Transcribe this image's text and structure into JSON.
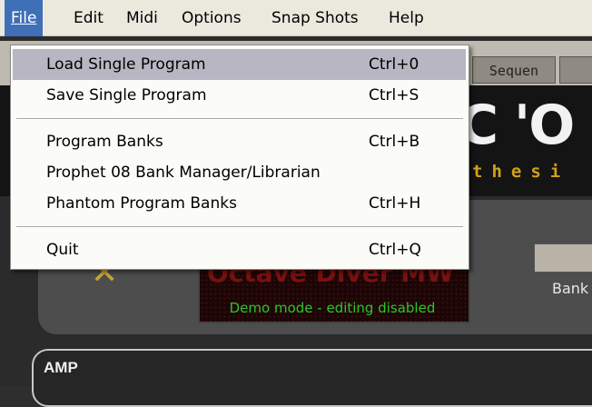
{
  "menubar": {
    "items": [
      {
        "label": "File"
      },
      {
        "label": "Edit"
      },
      {
        "label": "Midi"
      },
      {
        "label": "Options"
      },
      {
        "label": "Snap Shots"
      },
      {
        "label": "Help"
      }
    ]
  },
  "file_menu": {
    "items": [
      {
        "label": "Load Single Program",
        "shortcut": "Ctrl+0"
      },
      {
        "label": "Save Single Program",
        "shortcut": "Ctrl+S"
      },
      {
        "label": "Program Banks",
        "shortcut": "Ctrl+B"
      },
      {
        "label": "Prophet 08 Bank Manager/Librarian",
        "shortcut": ""
      },
      {
        "label": "Phantom Program Banks",
        "shortcut": "Ctrl+H"
      },
      {
        "label": "Quit",
        "shortcut": "Ctrl+Q"
      }
    ]
  },
  "background": {
    "tab_label": "Sequen",
    "logo_text": "C 'O",
    "logo_sub": "thesi",
    "display_title": "Octave Diver MW",
    "display_status": "Demo mode - editing disabled",
    "bank_label": "Bank",
    "section_label": "AMP"
  },
  "colors": {
    "menubar_bg": "#ebe9de",
    "menu_active": "#3f6fb6",
    "menu_highlight": "#b8b6c2",
    "display_text_green": "#2ec52e",
    "logo_gold": "#d4a017"
  }
}
